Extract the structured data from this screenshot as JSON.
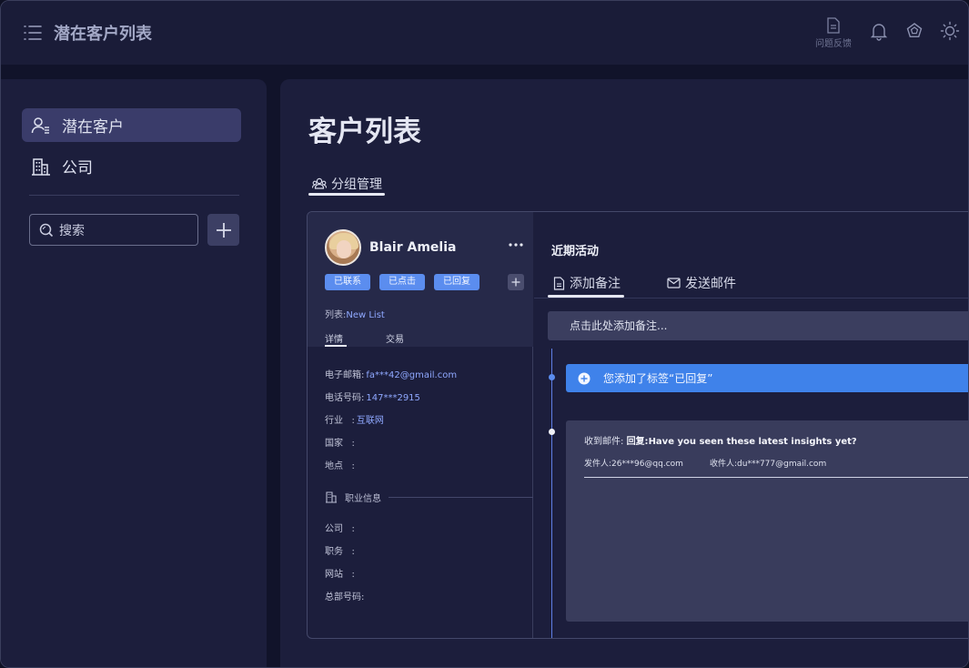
{
  "app": {
    "title": "潜在客户列表"
  },
  "topbar": {
    "feedback_label": "问题反馈",
    "icons": [
      "feedback-icon",
      "bell-icon",
      "badge-icon",
      "sun-icon"
    ]
  },
  "sidebar": {
    "items": [
      {
        "label": "潜在客户",
        "icon": "user-list-icon",
        "active": true
      },
      {
        "label": "公司",
        "icon": "building-icon",
        "active": false
      }
    ],
    "search_placeholder": "搜索"
  },
  "main": {
    "page_title": "客户列表",
    "tabs": [
      {
        "label": "分组管理",
        "icon": "group-icon"
      }
    ]
  },
  "contact": {
    "name": "Blair Amelia",
    "tags": [
      "已联系",
      "已点击",
      "已回复"
    ],
    "list_label": "列表:",
    "list_value": "New List",
    "sub_tabs": [
      "详情",
      "交易"
    ],
    "details": [
      {
        "label": "电子邮箱:",
        "value": "fa***42@gmail.com"
      },
      {
        "label": "电话号码:",
        "value": "147***2915"
      },
      {
        "label": "行业   :",
        "value": "互联网"
      },
      {
        "label": "国家   :",
        "value": ""
      },
      {
        "label": "地点   :",
        "value": ""
      }
    ],
    "job_section_title": "职业信息",
    "job_fields": [
      {
        "label": "公司   :",
        "value": ""
      },
      {
        "label": "职务   :",
        "value": ""
      },
      {
        "label": "网站   :",
        "value": ""
      },
      {
        "label": "总部号码:",
        "value": ""
      }
    ]
  },
  "activity": {
    "title": "近期活动",
    "tabs": [
      {
        "label": "添加备注",
        "icon": "note-icon"
      },
      {
        "label": "发送邮件",
        "icon": "mail-icon"
      }
    ],
    "note_placeholder": "点击此处添加备注...",
    "events": [
      {
        "type": "tag",
        "text": "您添加了标签“已回复”"
      },
      {
        "type": "email",
        "subject_label": "收到邮件:",
        "subject_prefix": "回复:",
        "subject": "Have you seen these latest insights yet?",
        "from": "发件人:26***96@qq.com",
        "to": "收件人:du***777@gmail.com"
      }
    ]
  },
  "colors": {
    "accent": "#5b8def",
    "tag_event": "#3f82ea",
    "link": "#8fa8ff",
    "panel": "#1c1e3c"
  }
}
